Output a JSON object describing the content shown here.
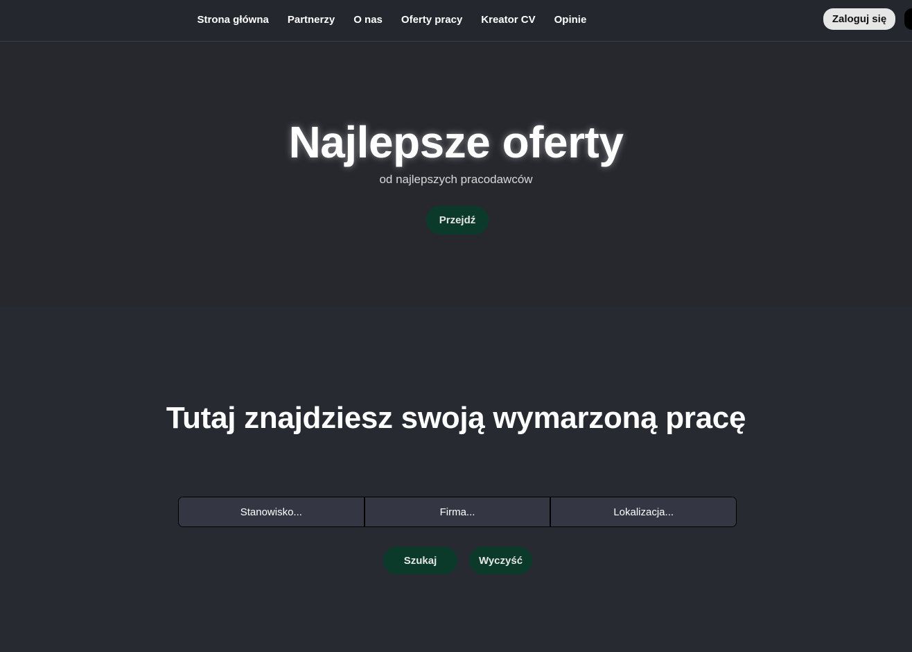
{
  "nav": {
    "links": [
      "Strona główna",
      "Partnerzy",
      "O nas",
      "Oferty pracy",
      "Kreator CV",
      "Opinie"
    ],
    "login_label": "Zaloguj się"
  },
  "hero": {
    "title": "Najlepsze oferty",
    "subtitle": "od najlepszych pracodawców",
    "button_label": "Przejdź"
  },
  "search": {
    "title": "Tutaj znajdziesz swoją wymarzoną pracę",
    "position_placeholder": "Stanowisko...",
    "company_placeholder": "Firma...",
    "location_placeholder": "Lokalizacja...",
    "search_label": "Szukaj",
    "clear_label": "Wyczyść"
  },
  "colors": {
    "background": "#272a31",
    "navbar": "#24272d",
    "accent_green": "#0b3a2a",
    "input_bg": "#343743"
  }
}
